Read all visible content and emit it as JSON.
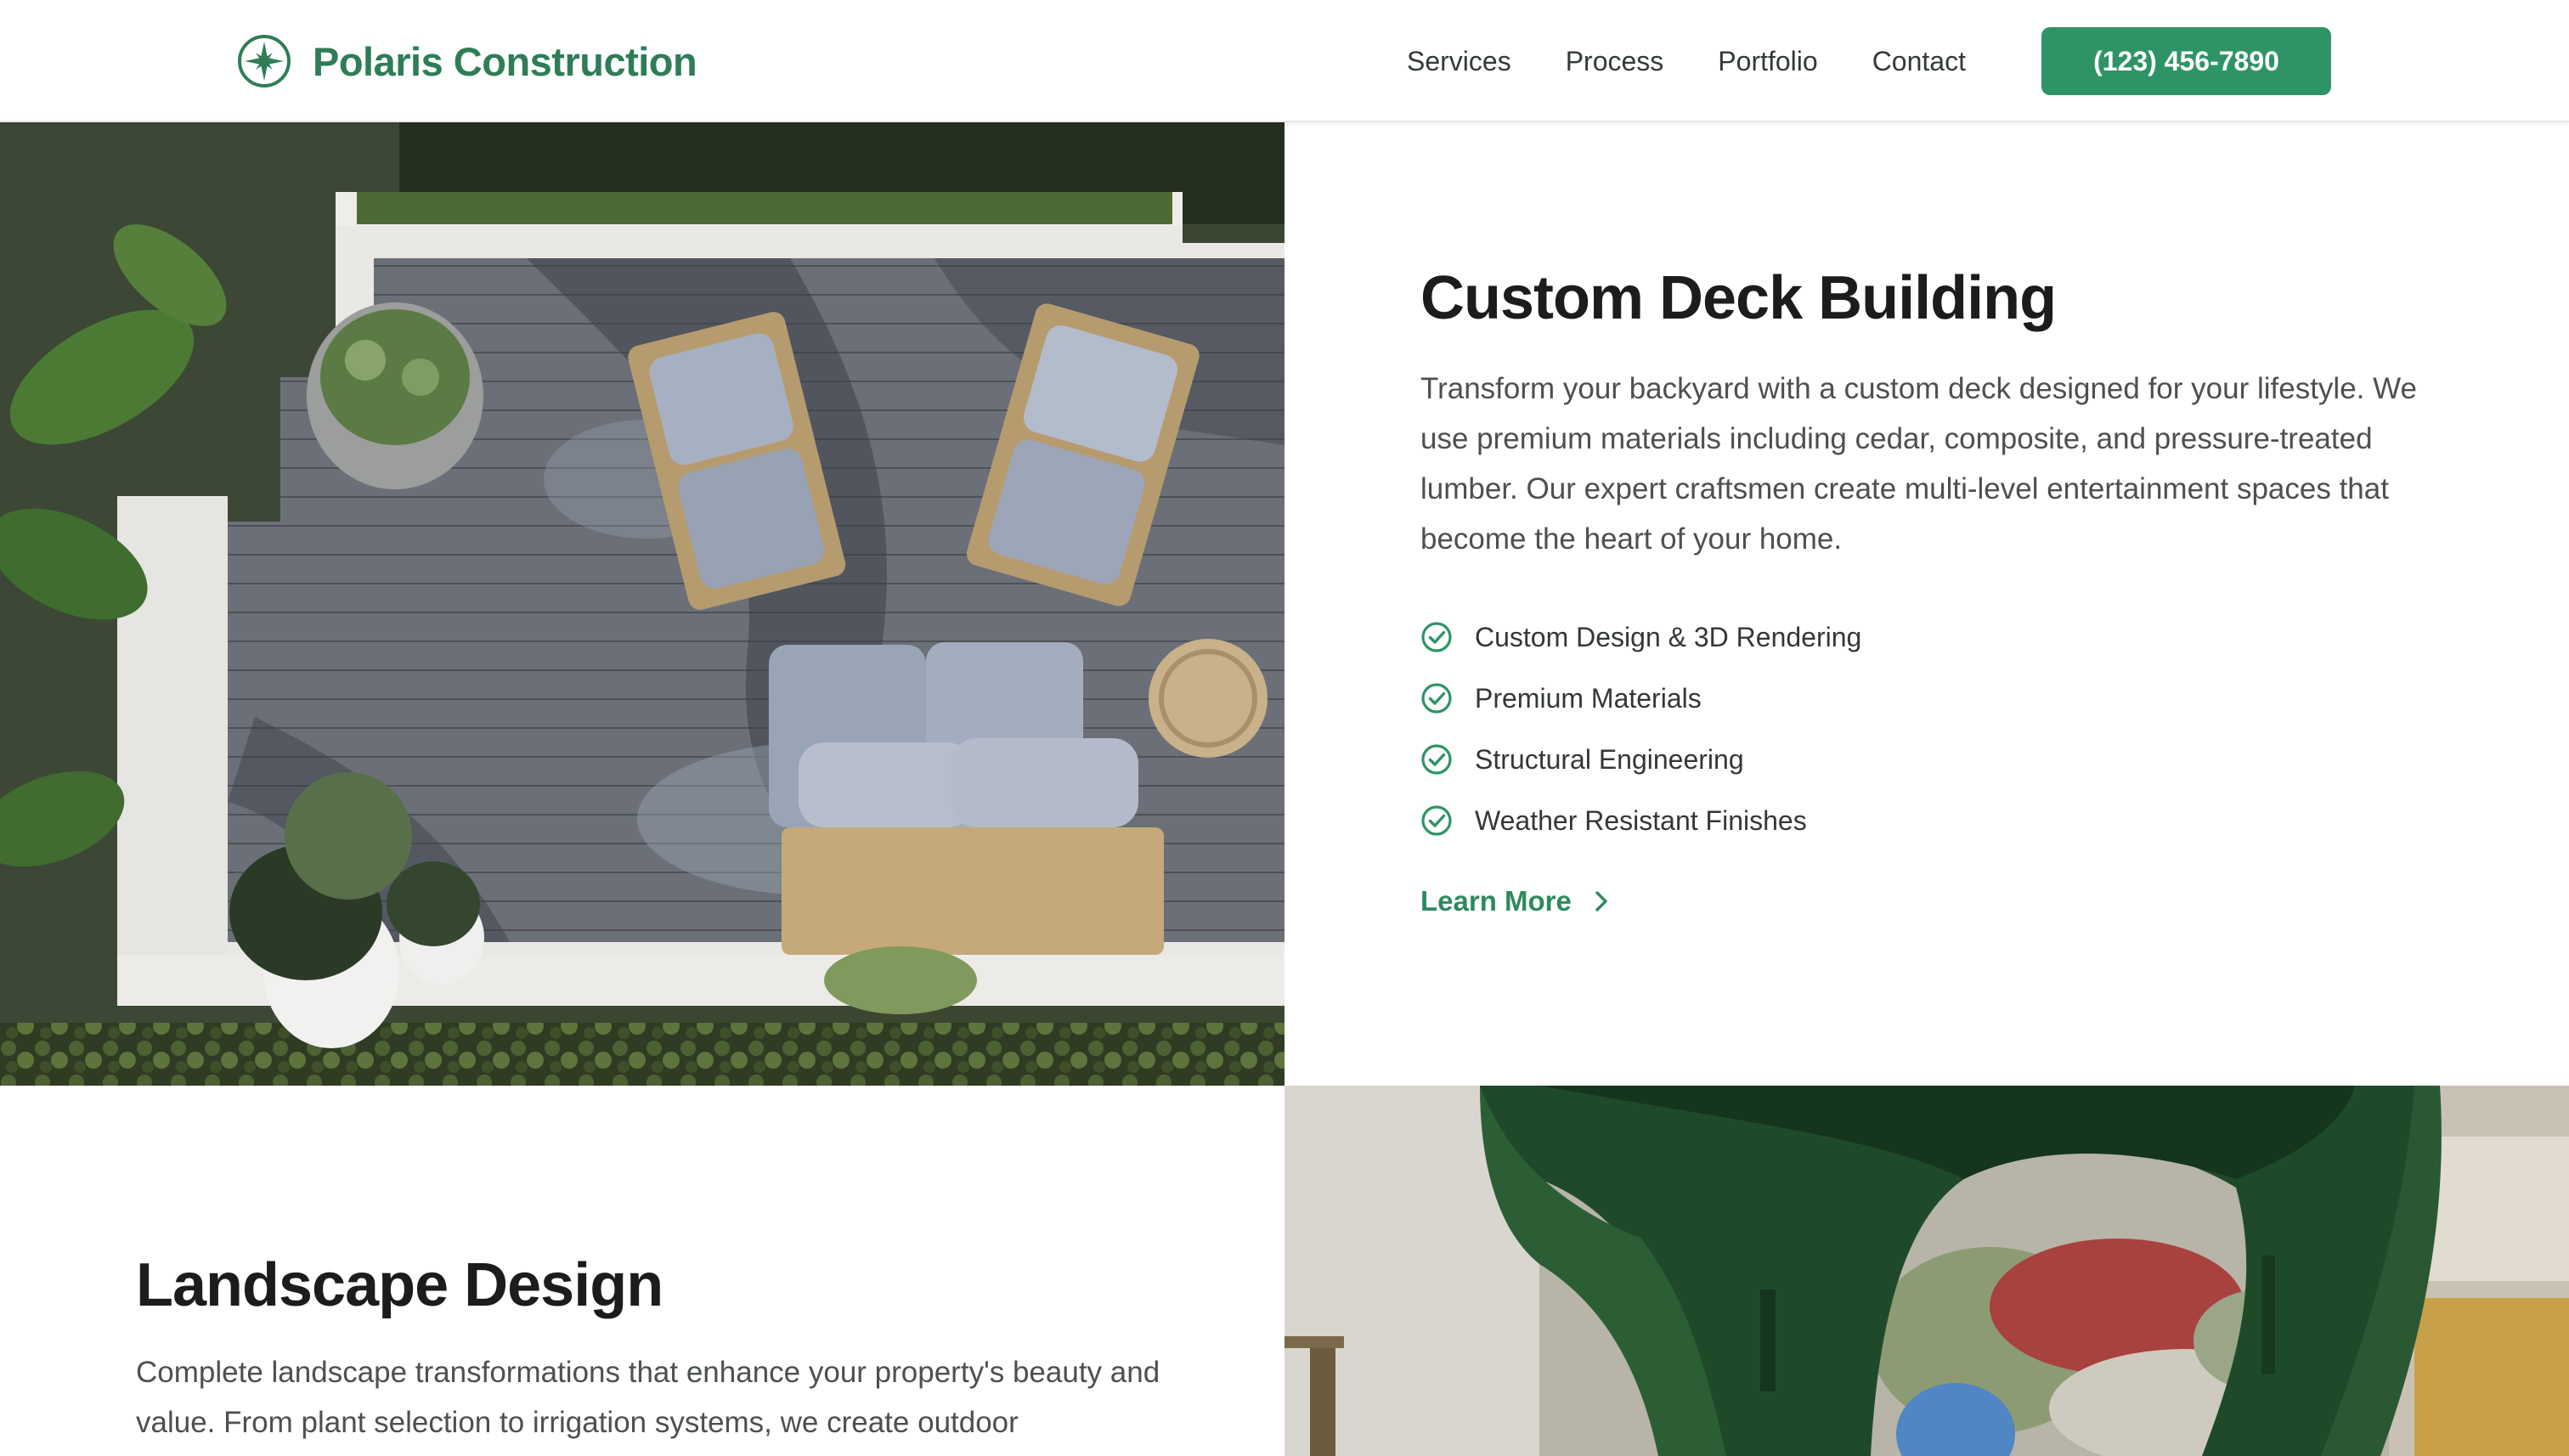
{
  "brand": {
    "name": "Polaris Construction",
    "logo_icon": "compass-star-icon",
    "color": "#2e7d57"
  },
  "nav": {
    "items": [
      "Services",
      "Process",
      "Portfolio",
      "Contact"
    ],
    "phone": "(123) 456-7890"
  },
  "colors": {
    "accent": "#2e9466",
    "text_dark": "#1b1d1c",
    "text_body": "#4c504e"
  },
  "sections": [
    {
      "title": "Custom Deck Building",
      "body": "Transform your backyard with a custom deck designed for your lifestyle. We use premium materials including cedar, composite, and pressure-treated lumber. Our expert craftsmen create multi-level entertainment spaces that become the heart of your home.",
      "features": [
        "Custom Design & 3D Rendering",
        "Premium Materials",
        "Structural Engineering",
        "Weather Resistant Finishes"
      ],
      "cta": "Learn More",
      "feature_icon": "check-circle-icon",
      "cta_icon": "chevron-right-icon"
    },
    {
      "title": "Landscape Design",
      "body": "Complete landscape transformations that enhance your property's beauty and value. From plant selection to irrigation systems, we create outdoor"
    }
  ]
}
